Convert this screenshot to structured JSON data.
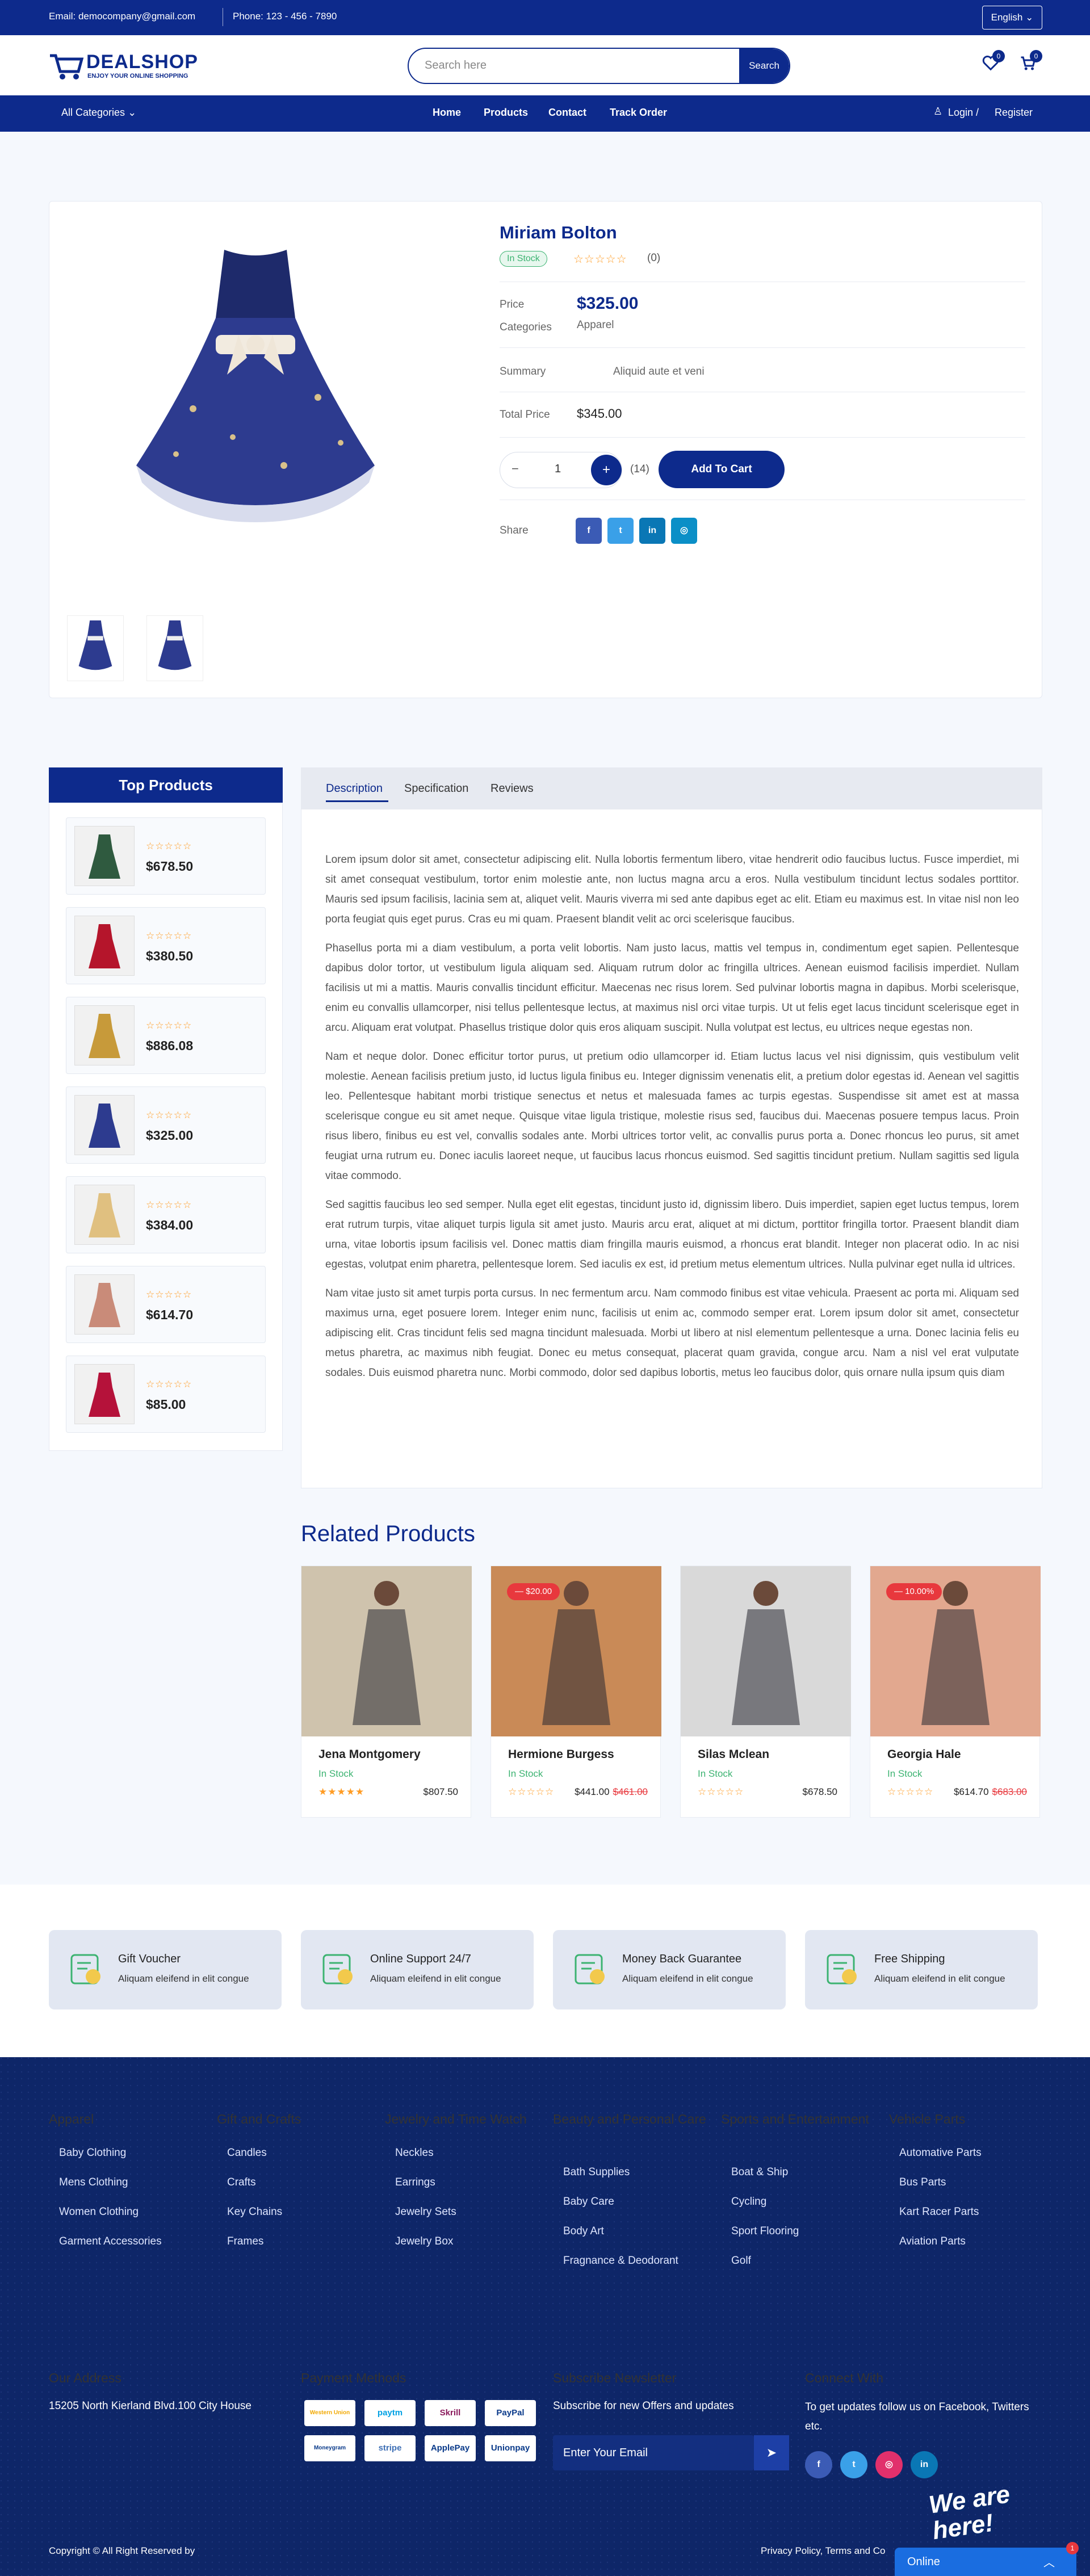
{
  "topbar": {
    "email": "Email: democompany@gmail.com",
    "phone": "Phone: 123 - 456 - 7890",
    "language": "English"
  },
  "header": {
    "logo_title": "DEALSHOP",
    "logo_tagline": "ENJOY YOUR ONLINE SHOPPING",
    "search_placeholder": "Search here",
    "search_button": "Search",
    "wishlist_count": "0",
    "cart_count": "0"
  },
  "nav": {
    "categories": "All Categories",
    "links": [
      "Home",
      "Products",
      "Contact",
      "Track Order"
    ],
    "login": "Login /",
    "register": "Register"
  },
  "product": {
    "name": "Miriam Bolton",
    "stock": "In Stock",
    "reviews": "(0)",
    "price_label": "Price",
    "price": "$325.00",
    "categories_label": "Categories",
    "category": "Apparel",
    "summary_label": "Summary",
    "summary": "Aliquid aute et veni",
    "total_label": "Total Price",
    "total": "$345.00",
    "qty": "1",
    "qty_available": "(14)",
    "add_to_cart": "Add To Cart",
    "share_label": "Share",
    "rating": 0
  },
  "top_products": {
    "title": "Top Products",
    "items": [
      {
        "price": "$678.50",
        "rating": 0
      },
      {
        "price": "$380.50",
        "rating": 0
      },
      {
        "price": "$886.08",
        "rating": 0
      },
      {
        "price": "$325.00",
        "rating": 0
      },
      {
        "price": "$384.00",
        "rating": 0
      },
      {
        "price": "$614.70",
        "rating": 0
      },
      {
        "price": "$85.00",
        "rating": 0
      }
    ]
  },
  "tabs": [
    "Description",
    "Specification",
    "Reviews"
  ],
  "description": [
    "Lorem ipsum dolor sit amet, consectetur adipiscing elit. Nulla lobortis fermentum libero, vitae hendrerit odio faucibus luctus. Fusce imperdiet, mi sit amet consequat vestibulum, tortor enim molestie ante, non luctus magna arcu a eros. Nulla vestibulum tincidunt lectus sodales porttitor. Mauris sed ipsum facilisis, lacinia sem at, aliquet velit. Mauris viverra mi sed ante dapibus eget ac elit. Etiam eu maximus est. In vitae nisl non leo porta feugiat quis eget purus. Cras eu mi quam. Praesent blandit velit ac orci scelerisque faucibus.",
    "Phasellus porta mi a diam vestibulum, a porta velit lobortis. Nam justo lacus, mattis vel tempus in, condimentum eget sapien. Pellentesque dapibus dolor tortor, ut vestibulum ligula aliquam sed. Aliquam rutrum dolor ac fringilla ultrices. Aenean euismod facilisis imperdiet. Nullam facilisis ut mi a mattis. Mauris convallis tincidunt efficitur. Maecenas nec risus lorem. Sed pulvinar lobortis magna in dapibus. Morbi scelerisque, enim eu convallis ullamcorper, nisi tellus pellentesque lectus, at maximus nisl orci vitae turpis. Ut ut felis eget lacus tincidunt scelerisque eget in arcu. Aliquam erat volutpat. Phasellus tristique dolor quis eros aliquam suscipit. Nulla volutpat est lectus, eu ultrices neque egestas non.",
    "Nam et neque dolor. Donec efficitur tortor purus, ut pretium odio ullamcorper id. Etiam luctus lacus vel nisi dignissim, quis vestibulum velit molestie. Aenean facilisis pretium justo, id luctus ligula finibus eu. Integer dignissim venenatis elit, a pretium dolor egestas id. Aenean vel sagittis leo. Pellentesque habitant morbi tristique senectus et netus et malesuada fames ac turpis egestas. Suspendisse sit amet est at massa scelerisque congue eu sit amet neque. Quisque vitae ligula tristique, molestie risus sed, faucibus dui. Maecenas posuere tempus lacus. Proin risus libero, finibus eu est vel, convallis sodales ante. Morbi ultrices tortor velit, ac convallis purus porta a. Donec rhoncus leo purus, sit amet feugiat urna rutrum eu. Donec iaculis laoreet neque, ut faucibus lacus rhoncus euismod. Sed sagittis tincidunt pretium. Nullam sagittis sed ligula vitae commodo.",
    "Sed sagittis faucibus leo sed semper. Nulla eget elit egestas, tincidunt justo id, dignissim libero. Duis imperdiet, sapien eget luctus tempus, lorem erat rutrum turpis, vitae aliquet turpis ligula sit amet justo. Mauris arcu erat, aliquet at mi dictum, porttitor fringilla tortor. Praesent blandit diam urna, vitae lobortis ipsum facilisis vel. Donec mattis diam fringilla mauris euismod, a rhoncus erat blandit. Integer non placerat odio. In ac nisi egestas, volutpat enim pharetra, pellentesque lorem. Sed iaculis ex est, id pretium metus elementum ultrices. Nulla pulvinar eget nulla id ultrices.",
    "Nam vitae justo sit amet turpis porta cursus. In nec fermentum arcu. Nam commodo finibus est vitae vehicula. Praesent ac porta mi. Aliquam sed maximus urna, eget posuere lorem. Integer enim nunc, facilisis ut enim ac, commodo semper erat. Lorem ipsum dolor sit amet, consectetur adipiscing elit. Cras tincidunt felis sed magna tincidunt malesuada. Morbi ut libero at nisl elementum pellentesque a urna. Donec lacinia felis eu metus pharetra, ac maximus nibh feugiat. Donec eu metus consequat, placerat quam gravida, congue arcu. Nam a nisl vel erat vulputate sodales. Duis euismod pharetra nunc. Morbi commodo, dolor sed dapibus lobortis, metus leo faucibus dolor, quis ornare nulla ipsum quis diam"
  ],
  "related": {
    "title": "Related Products",
    "items": [
      {
        "name": "Jena Montgomery",
        "stock": "In Stock",
        "price": "$807.50",
        "old": "",
        "badge": "",
        "rating": 5,
        "bg": "#cfc3ad"
      },
      {
        "name": "Hermione Burgess",
        "stock": "In Stock",
        "price": "$441.00",
        "old": "$461.00",
        "badge": "$20.00",
        "rating": 0,
        "bg": "#c98a57"
      },
      {
        "name": "Silas Mclean",
        "stock": "In Stock",
        "price": "$678.50",
        "old": "",
        "badge": "",
        "rating": 0,
        "bg": "#d9d9d9"
      },
      {
        "name": "Georgia Hale",
        "stock": "In Stock",
        "price": "$614.70",
        "old": "$683.00",
        "badge": "10.00%",
        "rating": 0,
        "bg": "#e2a88f"
      }
    ]
  },
  "features": [
    {
      "title": "Gift Voucher",
      "sub": "Aliquam eleifend in elit congue"
    },
    {
      "title": "Online Support 24/7",
      "sub": "Aliquam eleifend in elit congue"
    },
    {
      "title": "Money Back Guarantee",
      "sub": "Aliquam eleifend in elit congue"
    },
    {
      "title": "Free Shipping",
      "sub": "Aliquam eleifend in elit congue"
    }
  ],
  "footer": {
    "columns": [
      {
        "title": "Apparel",
        "links": [
          "Baby Clothing",
          "Mens Clothing",
          "Women Clothing",
          "Garment Accessories"
        ]
      },
      {
        "title": "Gift and Crafts",
        "links": [
          "Candles",
          "Crafts",
          "Key Chains",
          "Frames"
        ]
      },
      {
        "title": "Jewelry and Time Watch",
        "links": [
          "Neckles",
          "Earrings",
          "Jewelry Sets",
          "Jewelry Box"
        ]
      },
      {
        "title": "Beauty and Personal Care",
        "links": [
          "Bath Supplies",
          "Baby Care",
          "Body Art",
          "Fragnance & Deodorant"
        ]
      },
      {
        "title": "Sports and Entertainment",
        "links": [
          "Boat & Ship",
          "Cycling",
          "Sport Flooring",
          "Golf"
        ]
      },
      {
        "title": "Vehicle Parts",
        "links": [
          "Automative Parts",
          "Bus Parts",
          "Kart Racer Parts",
          "Aviation Parts"
        ]
      }
    ],
    "address_title": "Our Address",
    "address": "15205 North Kierland Blvd.100 City House",
    "payment_title": "Payment Methods",
    "payments": [
      "Western Union",
      "paytm",
      "Skrill",
      "PayPal",
      "Moneygram",
      "stripe",
      "ApplePay",
      "Unionpay"
    ],
    "newsletter_title": "Subscribe Newsletter",
    "newsletter_sub": "Subscribe for new Offers and updates",
    "email_placeholder": "Enter Your Email",
    "connect_title": "Connect With",
    "connect_sub": "To get updates follow us on Facebook, Twitters etc.",
    "copyright": "Copyright © All Right Reserved by",
    "policy": "Privacy Policy, Terms and Co",
    "chat_badge": "We are here!",
    "chat": "Online",
    "chat_count": "1"
  },
  "colors": {
    "brand": "#0d2a8c",
    "footer": "#0e2668",
    "star": "#ff9c24",
    "stock": "#3cb371",
    "sale": "#e8383d"
  }
}
